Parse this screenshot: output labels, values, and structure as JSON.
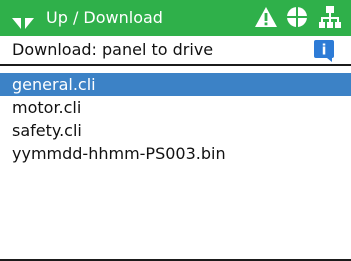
{
  "header": {
    "title": "Up / Download",
    "icons": [
      "transfer-arrows-icon",
      "warning-icon",
      "globe-icon",
      "network-icon"
    ],
    "background_color": "#2fb04a"
  },
  "subheader": {
    "label": "Download: panel to drive",
    "info_icon": "info-icon",
    "info_icon_text": "i",
    "info_color": "#2d7bd6"
  },
  "files": {
    "items": [
      {
        "label": "general.cli",
        "selected": true
      },
      {
        "label": "motor.cli",
        "selected": false
      },
      {
        "label": "safety.cli",
        "selected": false
      },
      {
        "label": "yymmdd-hhmm-PS003.bin",
        "selected": false
      }
    ],
    "selected_color": "#3c82c6"
  }
}
